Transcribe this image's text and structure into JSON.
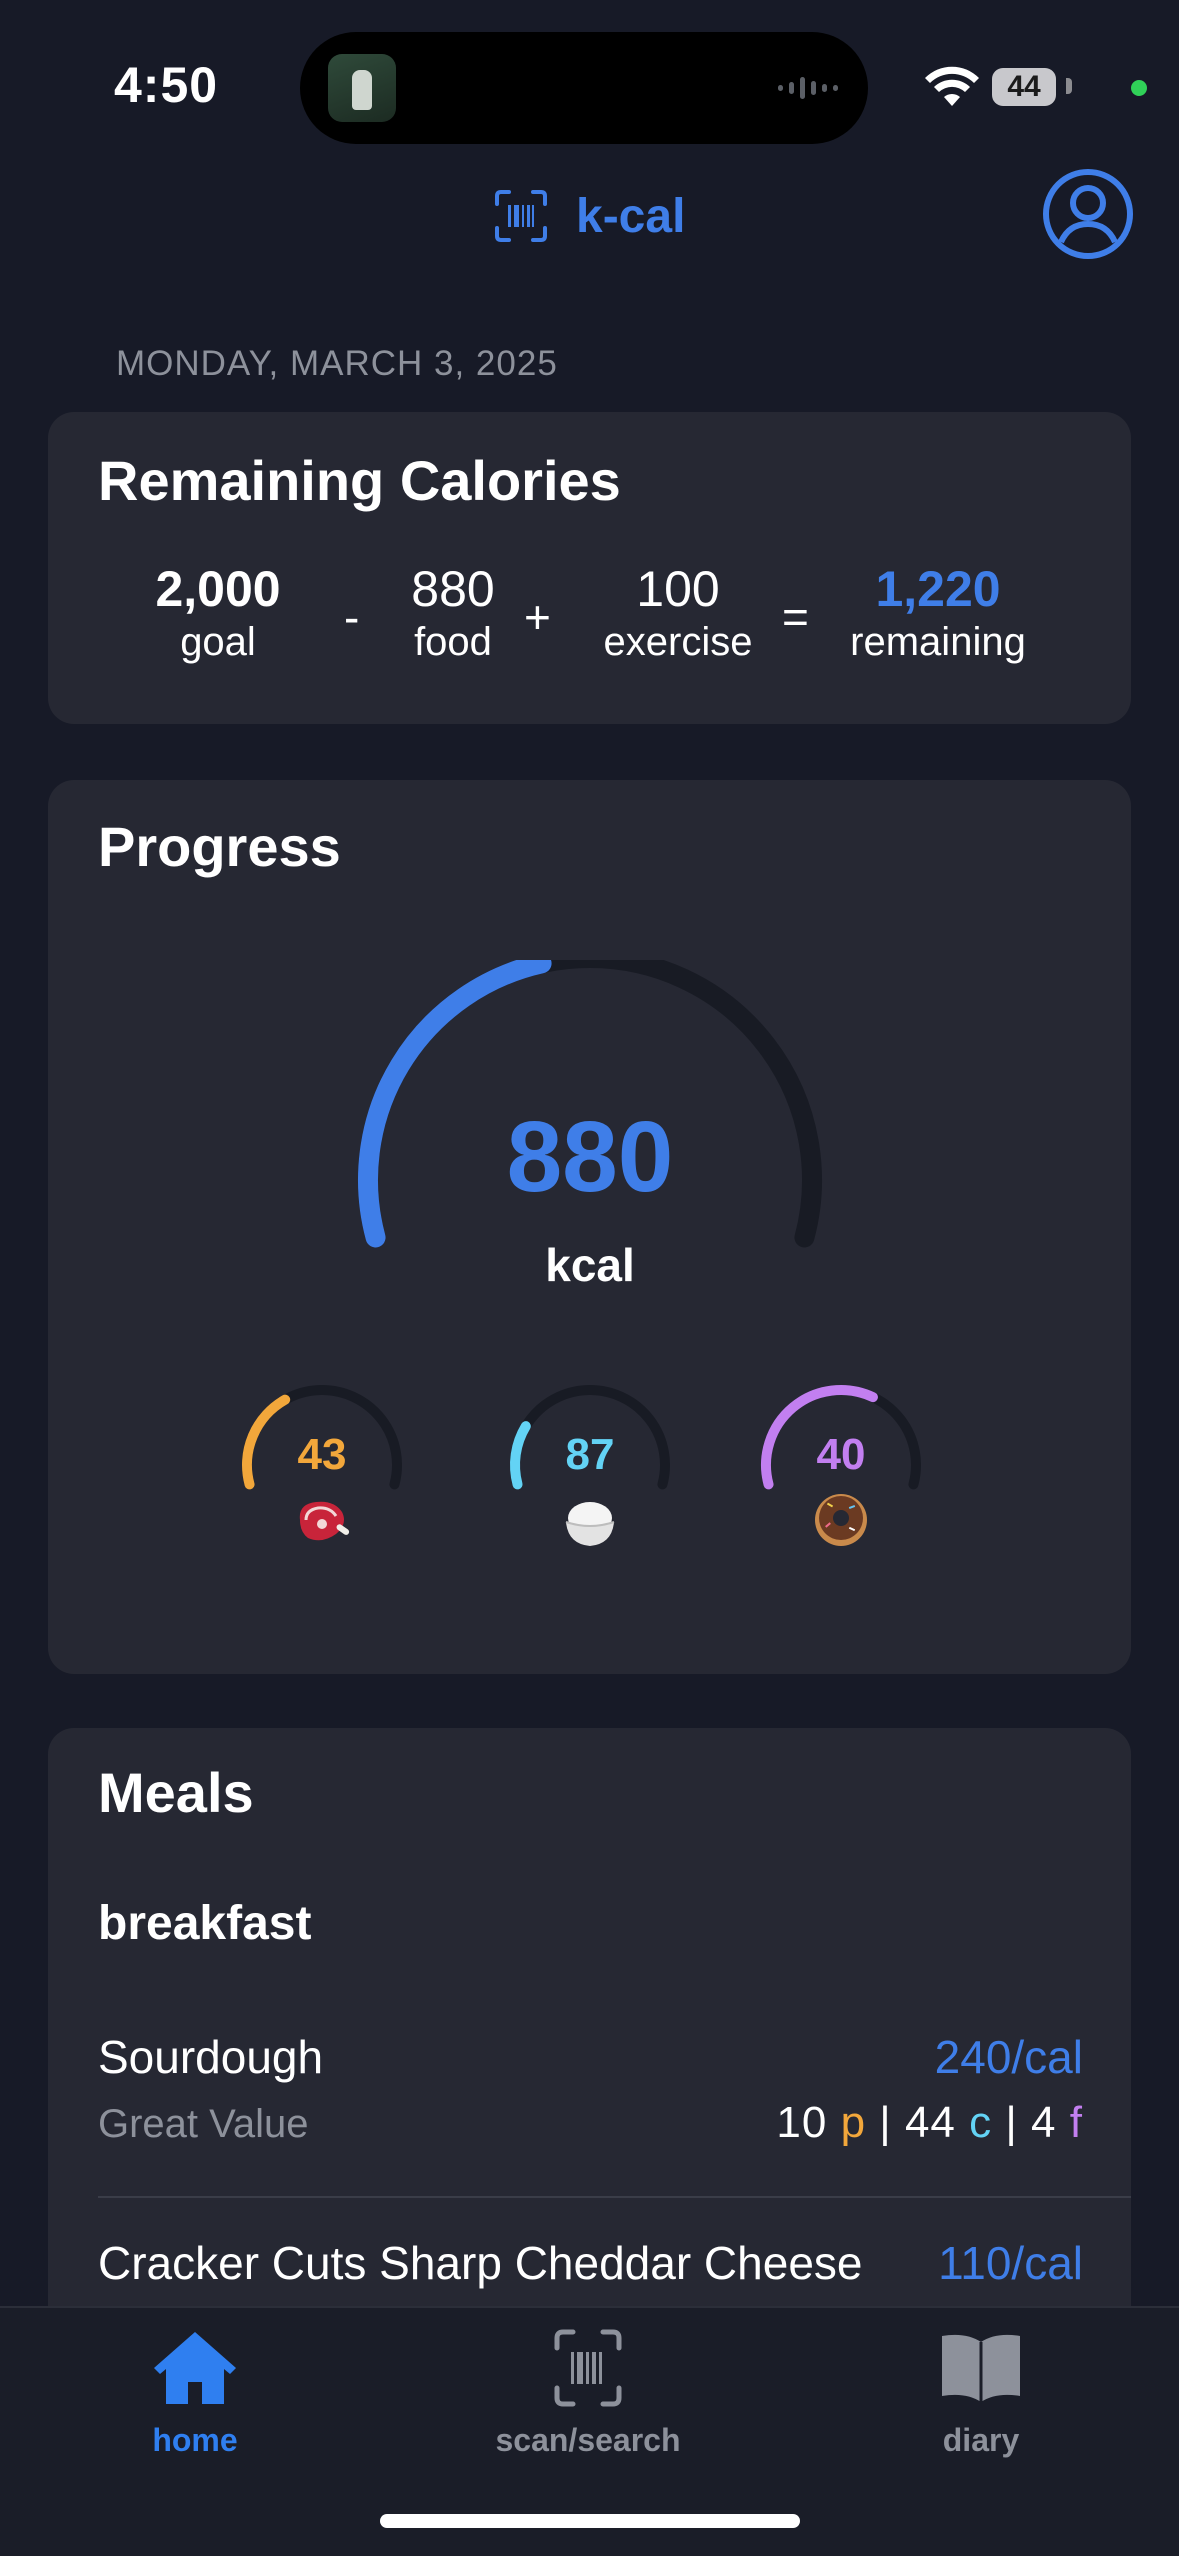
{
  "status_bar": {
    "time": "4:50",
    "battery": "44"
  },
  "header": {
    "app_name": "k-cal",
    "brand_icon": "barcode-scan-icon",
    "profile_icon": "person-circle-icon"
  },
  "date": "MONDAY, MARCH 3, 2025",
  "remaining_calories": {
    "title": "Remaining Calories",
    "goal": {
      "value": "2,000",
      "label": "goal"
    },
    "food": {
      "value": "880",
      "label": "food"
    },
    "exercise": {
      "value": "100",
      "label": "exercise"
    },
    "remaining": {
      "value": "1,220",
      "label": "remaining"
    },
    "op_minus": "-",
    "op_plus": "+",
    "op_equals": "="
  },
  "progress": {
    "title": "Progress",
    "kcal_value": "880",
    "kcal_unit": "kcal",
    "kcal_fraction": 0.44,
    "macros": [
      {
        "name": "protein",
        "value": "43",
        "icon": "steak-icon",
        "color": "#f2a73b",
        "fraction": 0.36
      },
      {
        "name": "carbs",
        "value": "87",
        "icon": "rice-bowl-icon",
        "color": "#63d3f5",
        "fraction": 0.22
      },
      {
        "name": "fat",
        "value": "40",
        "icon": "donut-icon",
        "color": "#c27ff0",
        "fraction": 0.62
      }
    ]
  },
  "meals": {
    "title": "Meals",
    "sections": [
      {
        "name": "breakfast",
        "items": [
          {
            "name": "Sourdough",
            "brand": "Great Value",
            "calories": "240/cal",
            "protein": "10",
            "carbs": "44",
            "fat": "4",
            "p_label": "p",
            "c_label": "c",
            "f_label": "f",
            "sep": "|"
          },
          {
            "name": "Cracker Cuts Sharp Cheddar Cheese",
            "calories": "110/cal"
          }
        ]
      }
    ]
  },
  "tabbar": {
    "tabs": [
      {
        "label": "home",
        "icon": "house-icon",
        "active": true
      },
      {
        "label": "scan/search",
        "icon": "barcode-scan-icon",
        "active": false
      },
      {
        "label": "diary",
        "icon": "book-icon",
        "active": false
      }
    ]
  },
  "colors": {
    "accent": "#3f7ee8",
    "background": "#171a27",
    "card": "#262833",
    "protein": "#f2a73b",
    "carbs": "#63d3f5",
    "fat": "#c27ff0"
  }
}
